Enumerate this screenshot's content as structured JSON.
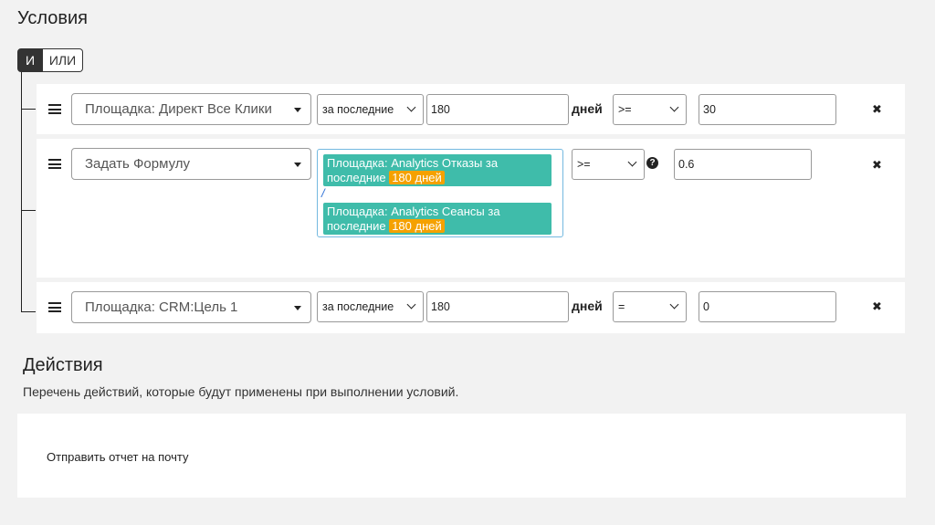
{
  "conditions": {
    "title": "Условия",
    "logic": {
      "and_label": "И",
      "or_label": "ИЛИ"
    },
    "rows": [
      {
        "source": "Площадка: Директ Все Клики",
        "period": "за последние",
        "days_value": "180",
        "days_label": "дней",
        "operator": ">=",
        "threshold": "30",
        "remove": "✖"
      },
      {
        "source": "Задать Формулу",
        "formula": {
          "numerator": "Площадка: Analytics Отказы за последние",
          "numerator_badge": "180 дней",
          "divider": "/",
          "denominator": "Площадка: Analytics Сеансы за последние",
          "denominator_badge": "180 дней"
        },
        "operator": ">=",
        "help": "?",
        "threshold": "0.6",
        "remove": "✖"
      },
      {
        "source": "Площадка: CRM:Цель 1",
        "period": "за последние",
        "days_value": "180",
        "days_label": "дней",
        "operator": "=",
        "threshold": "0",
        "remove": "✖"
      }
    ]
  },
  "actions": {
    "title": "Действия",
    "description": "Перечень действий, которые будут применены при выполнении условий.",
    "items": [
      "Отправить отчет на почту"
    ]
  }
}
